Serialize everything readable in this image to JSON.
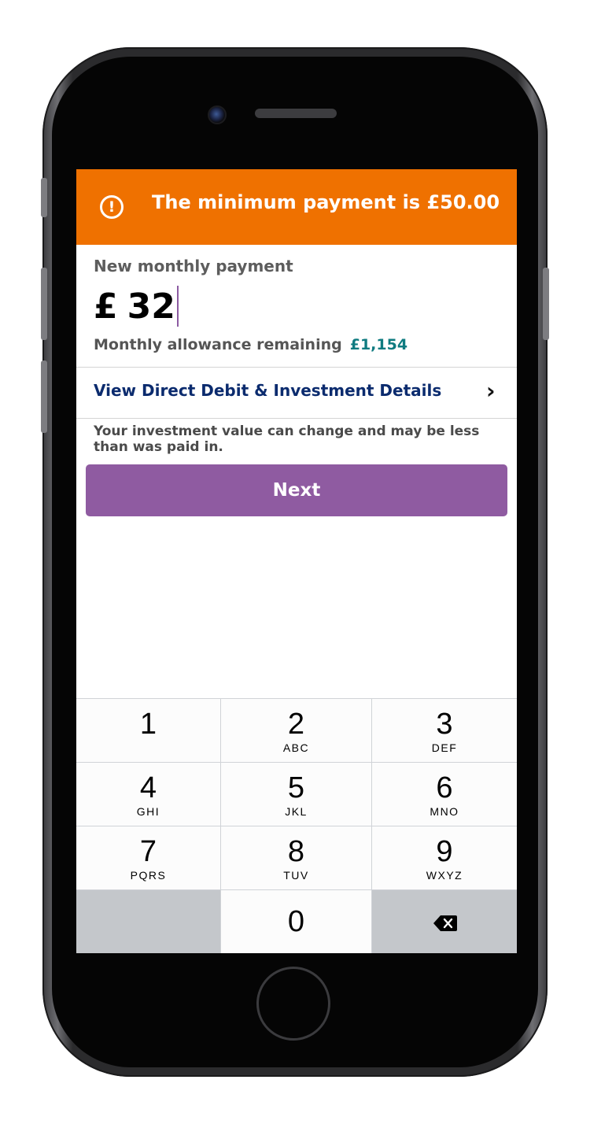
{
  "alert": {
    "icon": "exclamation-circle-icon",
    "icon_glyph": "!",
    "message": "The minimum payment is £50.00",
    "color": "#ef7100"
  },
  "payment": {
    "label": "New monthly payment",
    "currency": "£",
    "value": "32",
    "allowance_label": "Monthly allowance remaining",
    "allowance_value": "£1,154",
    "allowance_color": "#0f7b80"
  },
  "details_link": {
    "label": "View Direct Debit & Investment Details",
    "chevron": "›",
    "color": "#0b2b6e"
  },
  "disclaimer": "Your investment value can change and may be less than was paid in.",
  "next_button": {
    "label": "Next",
    "color": "#8f5ba1"
  },
  "keypad": {
    "keys": [
      {
        "digit": "1",
        "letters": ""
      },
      {
        "digit": "2",
        "letters": "ABC"
      },
      {
        "digit": "3",
        "letters": "DEF"
      },
      {
        "digit": "4",
        "letters": "GHI"
      },
      {
        "digit": "5",
        "letters": "JKL"
      },
      {
        "digit": "6",
        "letters": "MNO"
      },
      {
        "digit": "7",
        "letters": "PQRS"
      },
      {
        "digit": "8",
        "letters": "TUV"
      },
      {
        "digit": "9",
        "letters": "WXYZ"
      },
      {
        "digit": "0",
        "letters": ""
      }
    ],
    "backspace_icon": "backspace-icon"
  }
}
